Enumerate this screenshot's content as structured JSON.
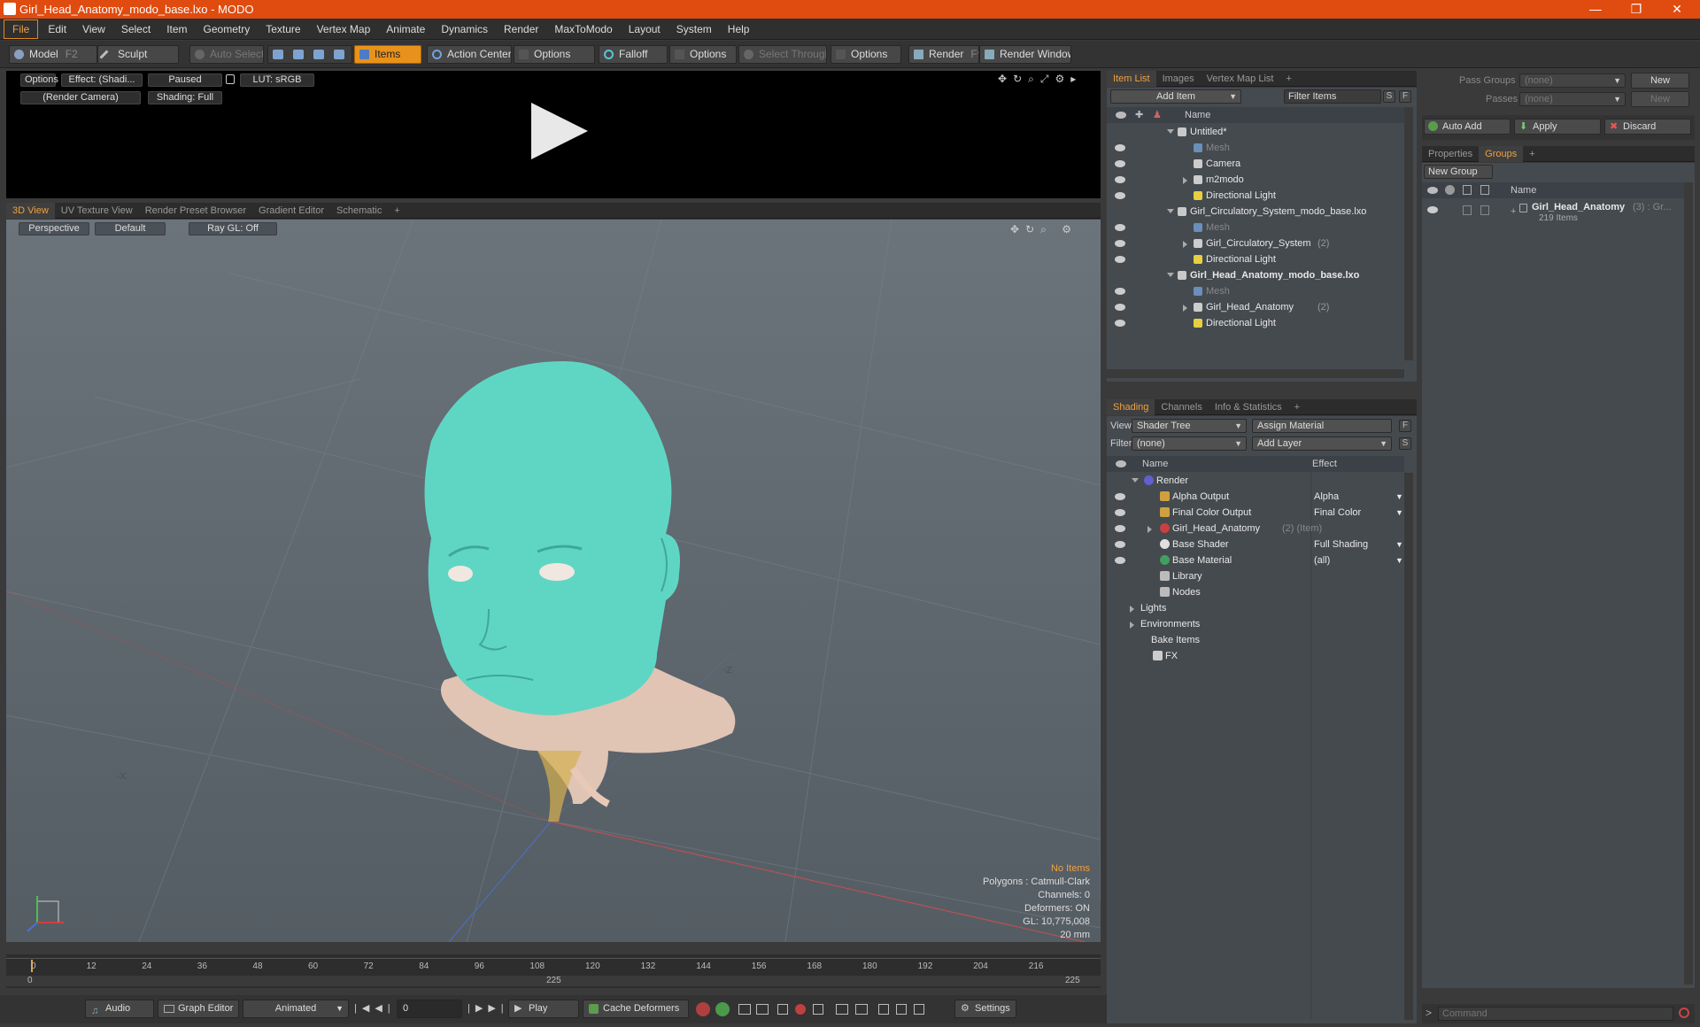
{
  "window": {
    "title": "Girl_Head_Anatomy_modo_base.lxo - MODO",
    "min": "—",
    "max": "❐",
    "close": "✕"
  },
  "menu": [
    "File",
    "Edit",
    "View",
    "Select",
    "Item",
    "Geometry",
    "Texture",
    "Vertex Map",
    "Animate",
    "Dynamics",
    "Render",
    "MaxToModo",
    "Layout",
    "System",
    "Help"
  ],
  "toolbar": {
    "model": "Model",
    "model_key": "F2",
    "sculpt": "Sculpt",
    "auto_select": "Auto Select",
    "items": "Items",
    "action_center": "Action Center",
    "options1": "Options",
    "falloff": "Falloff",
    "options2": "Options",
    "select_through": "Select Through",
    "options3": "Options",
    "render": "Render",
    "render_key": "F9",
    "render_window": "Render Window"
  },
  "preview": {
    "options": "Options",
    "effect": "Effect: (Shadi...",
    "paused": "Paused",
    "lut": "LUT: sRGB",
    "camera": "(Render Camera)",
    "shading": "Shading: Full"
  },
  "viewtabs": [
    "3D View",
    "UV Texture View",
    "Render Preset Browser",
    "Gradient Editor",
    "Schematic",
    "+"
  ],
  "viewport": {
    "perspective": "Perspective",
    "default": "Default",
    "raygl": "Ray GL: Off",
    "no_items": "No Items",
    "polygons": "Polygons : Catmull-Clark",
    "channels": "Channels: 0",
    "deformers": "Deformers: ON",
    "gl": "GL: 10,775,008",
    "size": "20 mm",
    "axis_x": "X",
    "axis_z": "Z",
    "axis_neg_x": "-X",
    "axis_neg_z": "-Z"
  },
  "timeline": {
    "ticks": [
      "0",
      "12",
      "24",
      "36",
      "48",
      "60",
      "72",
      "84",
      "96",
      "108",
      "120",
      "132",
      "144",
      "156",
      "168",
      "180",
      "192",
      "204",
      "216"
    ],
    "start": "0",
    "mid": "225",
    "end": "225"
  },
  "bottom": {
    "audio": "Audio",
    "graph_editor": "Graph Editor",
    "animated": "Animated",
    "frame": "0",
    "play": "Play",
    "cache": "Cache Deformers",
    "settings": "Settings"
  },
  "itemlist": {
    "tabs": [
      "Item List",
      "Images",
      "Vertex Map List",
      "+"
    ],
    "add_item": "Add Item",
    "filter_items": "Filter Items",
    "s": "S",
    "f": "F",
    "col_name": "Name",
    "rows": [
      {
        "label": "Untitled*",
        "count": ""
      },
      {
        "label": "Mesh",
        "count": ""
      },
      {
        "label": "Camera",
        "count": ""
      },
      {
        "label": "m2modo",
        "count": ""
      },
      {
        "label": "Directional Light",
        "count": ""
      },
      {
        "label": "Girl_Circulatory_System_modo_base.lxo",
        "count": ""
      },
      {
        "label": "Mesh",
        "count": ""
      },
      {
        "label": "Girl_Circulatory_System",
        "count": "(2)"
      },
      {
        "label": "Directional Light",
        "count": ""
      },
      {
        "label": "Girl_Head_Anatomy_modo_base.lxo",
        "count": ""
      },
      {
        "label": "Mesh",
        "count": ""
      },
      {
        "label": "Girl_Head_Anatomy",
        "count": "(2)"
      },
      {
        "label": "Directional Light",
        "count": ""
      }
    ]
  },
  "shading": {
    "tabs": [
      "Shading",
      "Channels",
      "Info & Statistics",
      "+"
    ],
    "view_label": "View",
    "view_value": "Shader Tree",
    "assign_material": "Assign Material",
    "f": "F",
    "filter_label": "Filter",
    "filter_value": "(none)",
    "add_layer": "Add Layer",
    "s": "S",
    "col_name": "Name",
    "col_effect": "Effect",
    "rows": [
      {
        "label": "Render",
        "extra": "",
        "effect": ""
      },
      {
        "label": "Alpha Output",
        "extra": "",
        "effect": "Alpha"
      },
      {
        "label": "Final Color Output",
        "extra": "",
        "effect": "Final Color"
      },
      {
        "label": "Girl_Head_Anatomy",
        "extra": "(2) (Item)",
        "effect": ""
      },
      {
        "label": "Base Shader",
        "extra": "",
        "effect": "Full Shading"
      },
      {
        "label": "Base Material",
        "extra": "",
        "effect": "(all)"
      },
      {
        "label": "Library",
        "extra": "",
        "effect": ""
      },
      {
        "label": "Nodes",
        "extra": "",
        "effect": ""
      },
      {
        "label": "Lights",
        "extra": "",
        "effect": ""
      },
      {
        "label": "Environments",
        "extra": "",
        "effect": ""
      },
      {
        "label": "Bake Items",
        "extra": "",
        "effect": ""
      },
      {
        "label": "FX",
        "extra": "",
        "effect": ""
      }
    ]
  },
  "passes": {
    "pass_groups": "Pass Groups",
    "passes": "Passes",
    "none1": "(none)",
    "none2": "(none)",
    "new1": "New",
    "new2": "New"
  },
  "actions": {
    "auto_add": "Auto Add",
    "apply": "Apply",
    "discard": "Discard"
  },
  "groups": {
    "tabs": [
      "Properties",
      "Groups",
      "+"
    ],
    "new_group": "New Group",
    "col_name": "Name",
    "item_name": "Girl_Head_Anatomy",
    "item_extra": "(3) : Gr...",
    "item_sub": "219 Items"
  },
  "command": {
    "placeholder": "Command"
  },
  "colors": {
    "accent": "#e8921c",
    "title_bar": "#e04b0f",
    "head": "#5fd6c4",
    "skin": "#e8c9b8"
  }
}
